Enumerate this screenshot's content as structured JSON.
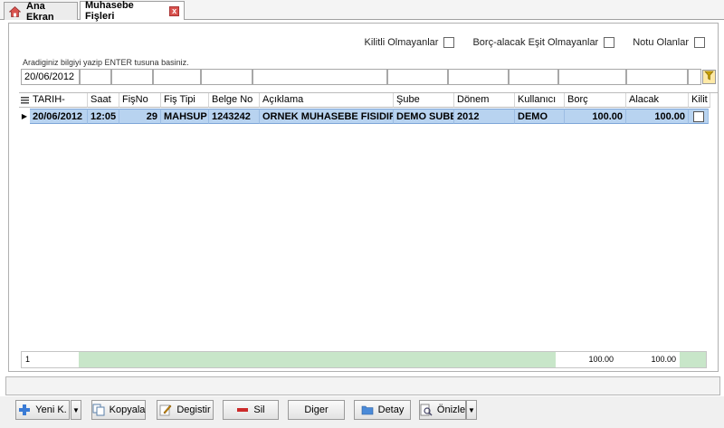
{
  "tabs": [
    {
      "label": "Ana Ekran",
      "icon": "home-icon"
    },
    {
      "label": "Muhasebe Fişleri",
      "icon": "close-icon",
      "close_label": "x"
    }
  ],
  "filters": {
    "kilitli": "Kilitli Olmayanlar",
    "borc_alacak": "Borç-alacak Eşit Olmayanlar",
    "notu": "Notu Olanlar"
  },
  "search_hint": "Aradiginiz bilgiyi yazip ENTER tusuna basiniz.",
  "filter_values": [
    "20/06/2012",
    "",
    "",
    "",
    "",
    "",
    "",
    "",
    "",
    "",
    ""
  ],
  "columns": [
    "TARIH-",
    "Saat",
    "FişNo",
    "Fiş Tipi",
    "Belge No",
    "Açıklama",
    "Şube",
    "Dönem",
    "Kullanıcı",
    "Borç",
    "Alacak",
    "Kilit"
  ],
  "rows": [
    {
      "tarih": "20/06/2012",
      "saat": "12:05",
      "fisno": "29",
      "fistipi": "MAHSUP",
      "belgeno": "1243242",
      "aciklama": "ORNEK MUHASEBE FISIDIR",
      "sube": "DEMO SUBE",
      "donem": "2012",
      "kullanici": "DEMO",
      "borc": "100.00",
      "alacak": "100.00",
      "kilit": false
    }
  ],
  "summary": {
    "count": "1",
    "borc": "100.00",
    "alacak": "100.00"
  },
  "buttons": {
    "yeni": "Yeni K.",
    "kopyala": "Kopyala",
    "degistir": "Degistir",
    "sil": "Sil",
    "diger": "Diger",
    "detay": "Detay",
    "onizle": "Önizle",
    "dropdown": "▼"
  },
  "colors": {
    "selected_row": "#b8d3f0",
    "summary_green": "#c8e6c9"
  }
}
